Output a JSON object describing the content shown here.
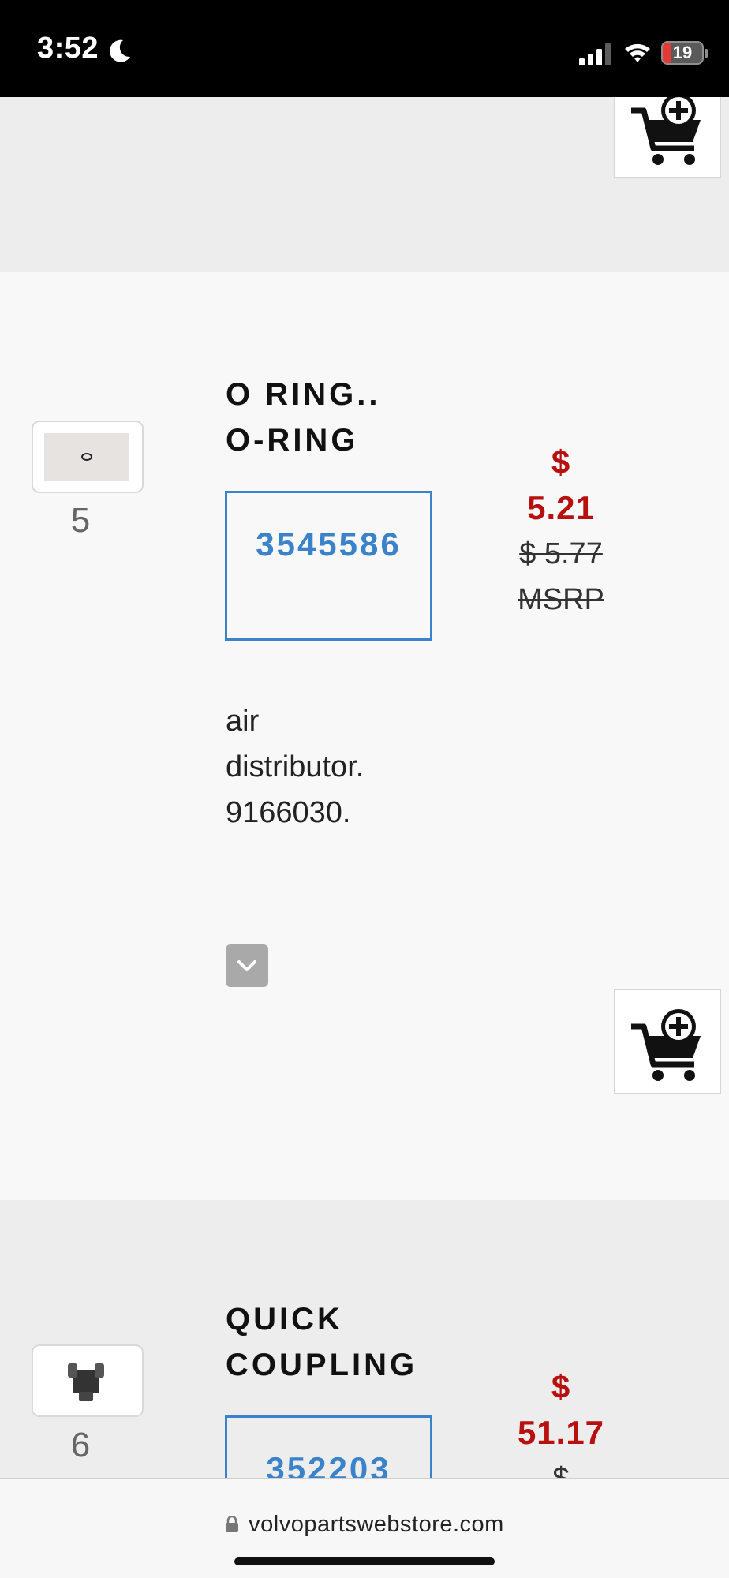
{
  "status_bar": {
    "time": "3:52",
    "battery_level": "19",
    "battery_fraction": 0.19,
    "icons": [
      "moon-icon",
      "signal-icon",
      "wifi-icon",
      "battery-icon"
    ]
  },
  "items": [
    {
      "index": "5",
      "title_line1": "O RING..",
      "title_line2": "O-RING",
      "part_number": "3545586",
      "price_symbol": "$",
      "price": "5.21",
      "msrp": "$ 5.77",
      "msrp_label": "MSRP",
      "description_lines": [
        "air",
        "distributor.",
        "9166030."
      ]
    },
    {
      "index": "6",
      "title_line1": "QUICK",
      "title_line2": "COUPLING",
      "part_number": "352203",
      "price_symbol": "$",
      "price": "51.17",
      "msrp_partial": "$"
    }
  ],
  "browser": {
    "url": "volvopartswebstore.com"
  },
  "colors": {
    "price_red": "#b80f0f",
    "part_link_blue": "#3a82c9",
    "status_bar_bg": "#000000",
    "battery_low": "#e53935"
  }
}
